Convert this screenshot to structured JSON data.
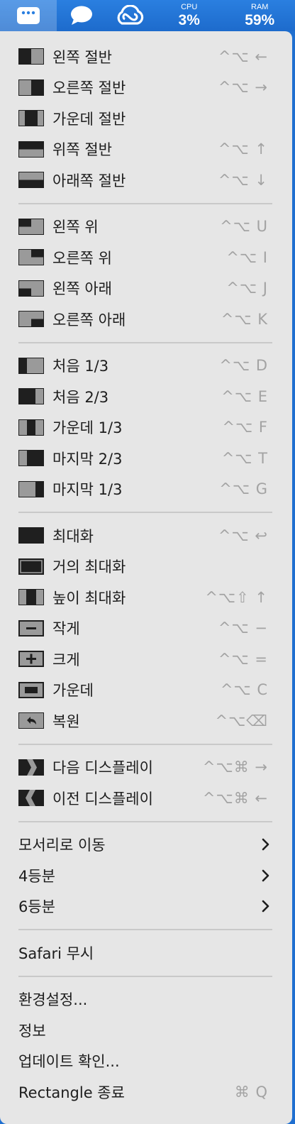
{
  "menubar": {
    "items": [
      {
        "name": "rectangle-app-icon"
      },
      {
        "name": "messages-icon"
      },
      {
        "name": "creative-cloud-icon"
      }
    ],
    "cpu": {
      "label": "CPU",
      "value": "3%"
    },
    "ram": {
      "label": "RAM",
      "value": "59%"
    }
  },
  "menu": {
    "groups": [
      [
        {
          "label": "왼쪽 절반",
          "shortcut": "^⌥ ←",
          "icon": "left-half-icon"
        },
        {
          "label": "오른쪽 절반",
          "shortcut": "^⌥ →",
          "icon": "right-half-icon"
        },
        {
          "label": "가운데 절반",
          "shortcut": "",
          "icon": "center-half-icon"
        },
        {
          "label": "위쪽 절반",
          "shortcut": "^⌥ ↑",
          "icon": "top-half-icon"
        },
        {
          "label": "아래쪽 절반",
          "shortcut": "^⌥ ↓",
          "icon": "bottom-half-icon"
        }
      ],
      [
        {
          "label": "왼쪽 위",
          "shortcut": "^⌥ U",
          "icon": "top-left-icon"
        },
        {
          "label": "오른쪽 위",
          "shortcut": "^⌥ I",
          "icon": "top-right-icon"
        },
        {
          "label": "왼쪽 아래",
          "shortcut": "^⌥ J",
          "icon": "bottom-left-icon"
        },
        {
          "label": "오른쪽 아래",
          "shortcut": "^⌥ K",
          "icon": "bottom-right-icon"
        }
      ],
      [
        {
          "label": "처음 1/3",
          "shortcut": "^⌥ D",
          "icon": "first-third-icon"
        },
        {
          "label": "처음 2/3",
          "shortcut": "^⌥ E",
          "icon": "first-two-thirds-icon"
        },
        {
          "label": "가운데 1/3",
          "shortcut": "^⌥ F",
          "icon": "center-third-icon"
        },
        {
          "label": "마지막 2/3",
          "shortcut": "^⌥ T",
          "icon": "last-two-thirds-icon"
        },
        {
          "label": "마지막 1/3",
          "shortcut": "^⌥ G",
          "icon": "last-third-icon"
        }
      ],
      [
        {
          "label": "최대화",
          "shortcut": "^⌥ ↩",
          "icon": "maximize-icon"
        },
        {
          "label": "거의 최대화",
          "shortcut": "",
          "icon": "almost-maximize-icon"
        },
        {
          "label": "높이 최대화",
          "shortcut": "^⌥⇧ ↑",
          "icon": "maximize-height-icon"
        },
        {
          "label": "작게",
          "shortcut": "^⌥ −",
          "icon": "smaller-icon"
        },
        {
          "label": "크게",
          "shortcut": "^⌥ =",
          "icon": "larger-icon"
        },
        {
          "label": "가운데",
          "shortcut": "^⌥ C",
          "icon": "center-icon"
        },
        {
          "label": "복원",
          "shortcut": "^⌥⌫",
          "icon": "restore-icon"
        }
      ],
      [
        {
          "label": "다음 디스플레이",
          "shortcut": "^⌥⌘ →",
          "icon": "next-display-icon"
        },
        {
          "label": "이전 디스플레이",
          "shortcut": "^⌥⌘ ←",
          "icon": "previous-display-icon"
        }
      ],
      [
        {
          "label": "모서리로 이동",
          "submenu": true
        },
        {
          "label": "4등분",
          "submenu": true
        },
        {
          "label": "6등분",
          "submenu": true
        }
      ],
      [
        {
          "label": "Safari 무시"
        }
      ],
      [
        {
          "label": "환경설정..."
        },
        {
          "label": "정보"
        },
        {
          "label": "업데이트 확인..."
        },
        {
          "label": "Rectangle 종료",
          "shortcut": "⌘ Q"
        }
      ]
    ]
  },
  "colors": {
    "menubar": "#1f6fd0",
    "menu_bg": "#e6e6e6",
    "icon_fill": "#1f1f1f",
    "icon_bg": "#9a9a9a",
    "shortcut": "#a3a3a3"
  }
}
